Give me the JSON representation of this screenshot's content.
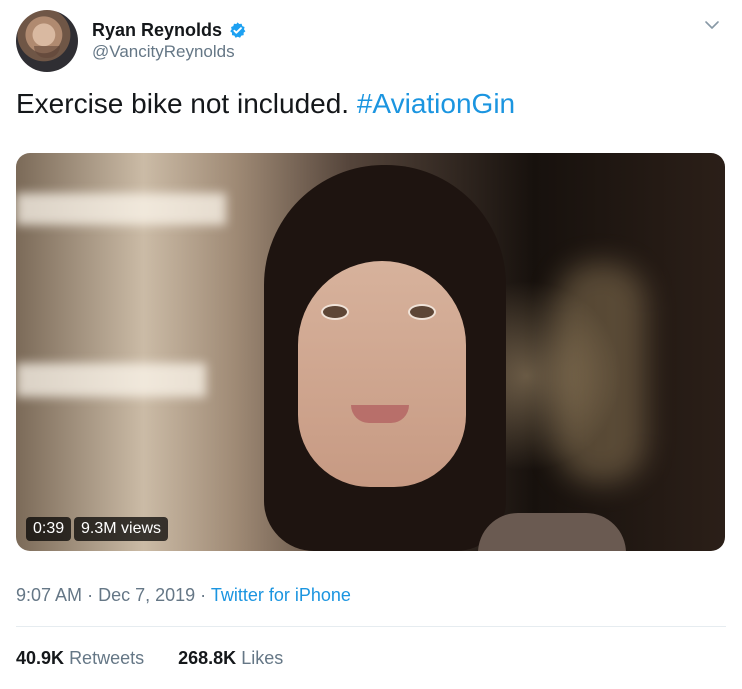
{
  "tweet": {
    "author": {
      "name": "Ryan Reynolds",
      "handle": "@VancityReynolds"
    },
    "text": "Exercise bike not included.",
    "hashtag": "#AviationGin",
    "video": {
      "duration": "0:39",
      "views": "9.3M views"
    },
    "meta": {
      "time": "9:07 AM",
      "separator": "·",
      "date": "Dec 7, 2019",
      "source": "Twitter for iPhone"
    },
    "stats": {
      "retweets_count": "40.9K",
      "retweets_label": "Retweets",
      "likes_count": "268.8K",
      "likes_label": "Likes"
    }
  },
  "colors": {
    "text": "#14171a",
    "secondary_text": "#657786",
    "accent": "#1b95e0",
    "verified": "#1da1f2"
  },
  "icons": [
    "verified-badge-icon",
    "chevron-down-icon"
  ]
}
